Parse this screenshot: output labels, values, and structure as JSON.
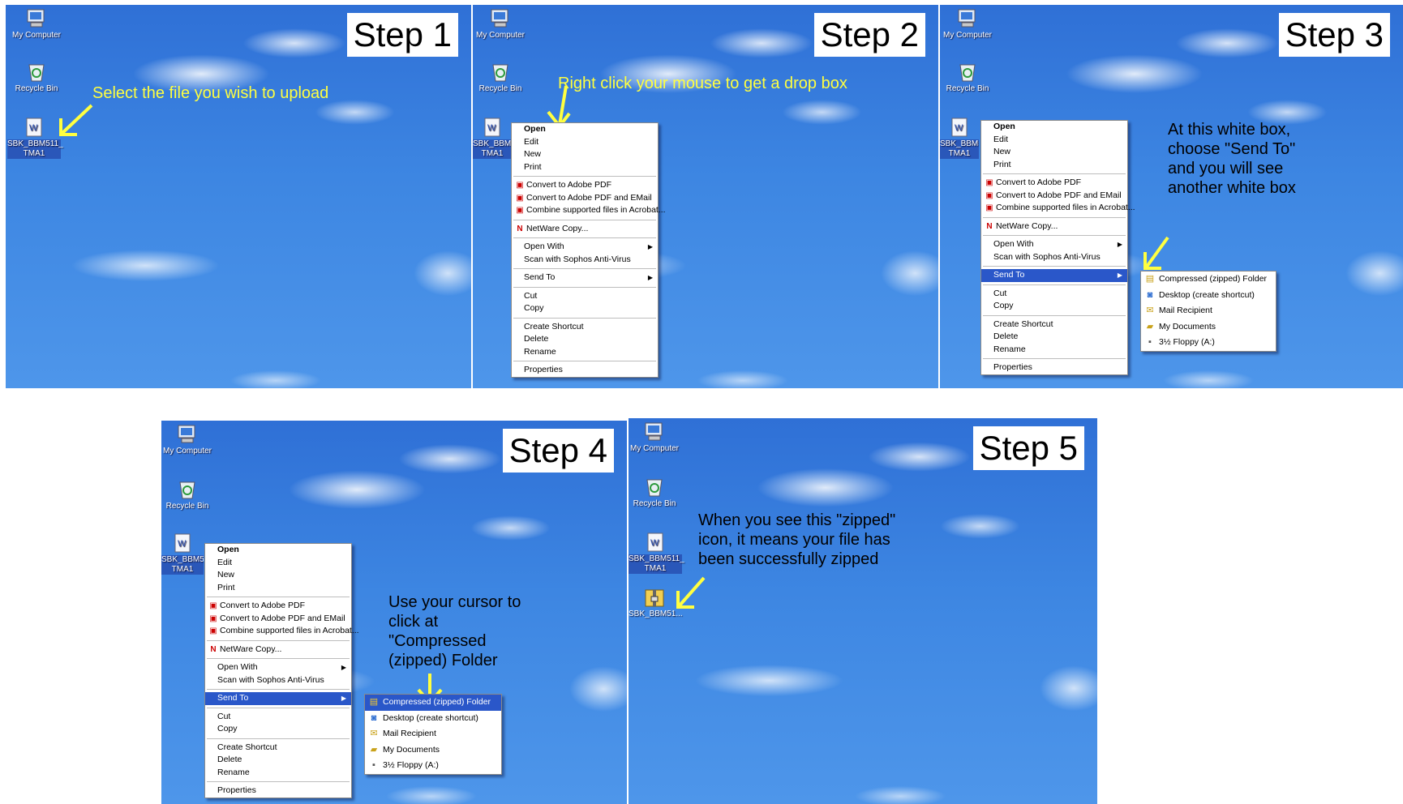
{
  "desktop": {
    "my_computer": "My Computer",
    "recycle_bin": "Recycle Bin",
    "file_label": "SBK_BBM511_ TMA1",
    "file_label_short": "SBK_BBM5 TMA1",
    "file_label_mid": "SBK_BBM51 TMA1",
    "zip_label": "SBK_BBM51..."
  },
  "steps": {
    "s1": "Step 1",
    "s2": "Step 2",
    "s3": "Step 3",
    "s4": "Step 4",
    "s5": "Step 5"
  },
  "annotations": {
    "a1": "Select the file you wish to upload",
    "a2": "Right click your mouse to get a drop box",
    "a3": "At this white box, choose \"Send To\" and you will see another white box",
    "a4": "Use your cursor to click at \"Compressed (zipped) Folder",
    "a5": "When you see this \"zipped\" icon, it means your file has been successfully zipped"
  },
  "context_menu": {
    "open": "Open",
    "edit": "Edit",
    "new": "New",
    "print": "Print",
    "convert_pdf": "Convert to Adobe PDF",
    "convert_pdf_email": "Convert to Adobe PDF and EMail",
    "combine": "Combine supported files in Acrobat...",
    "netware": "NetWare Copy...",
    "open_with": "Open With",
    "scan": "Scan with Sophos Anti-Virus",
    "send_to": "Send To",
    "cut": "Cut",
    "copy": "Copy",
    "create_shortcut": "Create Shortcut",
    "delete": "Delete",
    "rename": "Rename",
    "properties": "Properties"
  },
  "send_to_menu": {
    "compressed": "Compressed (zipped) Folder",
    "desktop": "Desktop (create shortcut)",
    "mail": "Mail Recipient",
    "documents": "My Documents",
    "floppy": "3½ Floppy (A:)"
  },
  "colors": {
    "annotation": "#ffff40",
    "highlight": "#2a57c9",
    "sky": "#3d86e2"
  }
}
